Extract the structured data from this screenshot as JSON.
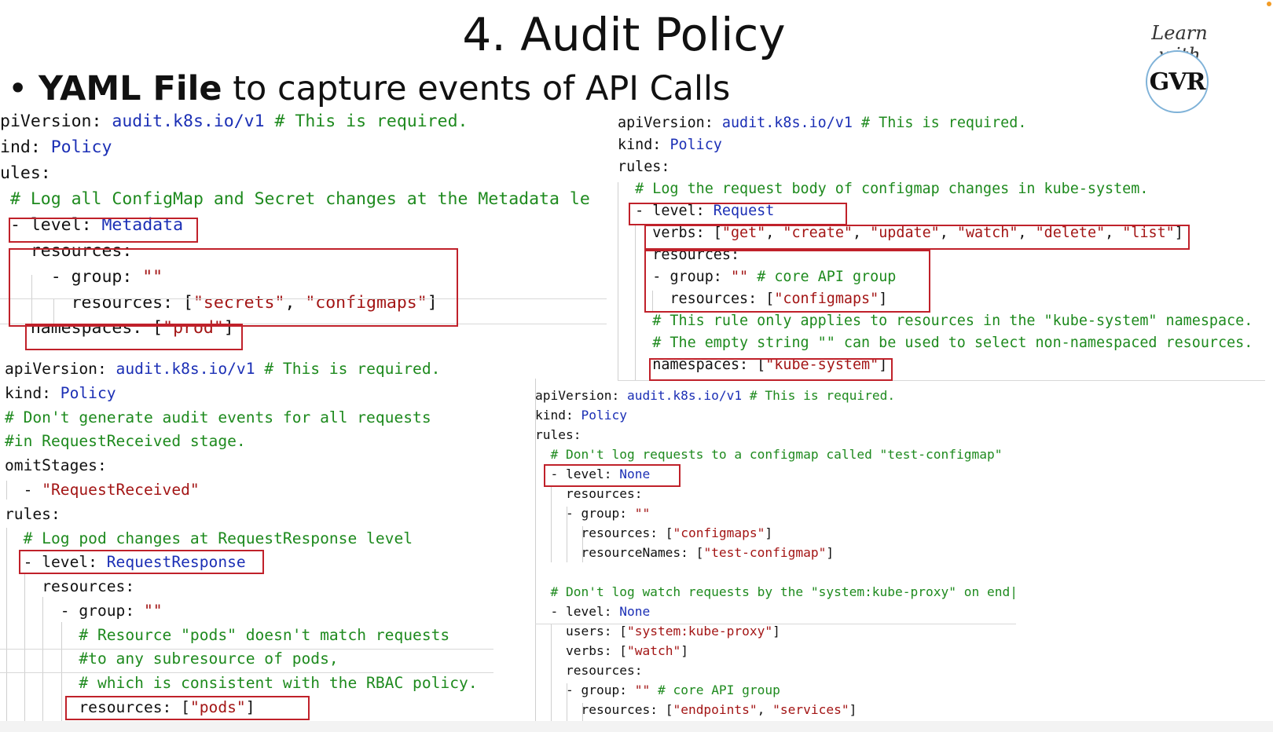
{
  "title": "4. Audit Policy",
  "bullet": {
    "bold": "YAML File",
    "rest": " to capture events of API Calls"
  },
  "logo": {
    "text": "Learn with",
    "mark": "GVR"
  },
  "panel1": [
    "piVersion: audit.k8s.io/v1 # This is required.",
    "ind: Policy",
    "ules:",
    " # Log all ConfigMap and Secret changes at the Metadata le",
    " - level: Metadata",
    "   resources:",
    "     - group: \"\"",
    "       resources: [\"secrets\", \"configmaps\"]",
    "   namespaces: [\"prod\"]"
  ],
  "panel2": [
    "apiVersion: audit.k8s.io/v1 # This is required.",
    "kind: Policy",
    "rules:",
    "  # Log the request body of configmap changes in kube-system.",
    "  - level: Request",
    "    verbs: [\"get\", \"create\", \"update\", \"watch\", \"delete\", \"list\"]",
    "    resources:",
    "    - group: \"\" # core API group",
    "      resources: [\"configmaps\"]",
    "    # This rule only applies to resources in the \"kube-system\" namespace.",
    "    # The empty string \"\" can be used to select non-namespaced resources.",
    "    namespaces: [\"kube-system\"]"
  ],
  "panel3": [
    "apiVersion: audit.k8s.io/v1 # This is required.",
    "kind: Policy",
    "# Don't generate audit events for all requests",
    "#in RequestReceived stage.",
    "omitStages:",
    "  - \"RequestReceived\"",
    "rules:",
    "  # Log pod changes at RequestResponse level",
    "  - level: RequestResponse",
    "    resources:",
    "      - group: \"\"",
    "        # Resource \"pods\" doesn't match requests",
    "        #to any subresource of pods,",
    "        # which is consistent with the RBAC policy.",
    "        resources: [\"pods\"]"
  ],
  "panel4": [
    "apiVersion: audit.k8s.io/v1 # This is required.",
    "kind: Policy",
    "rules:",
    "  # Don't log requests to a configmap called \"test-configmap\"",
    "  - level: None",
    "    resources:",
    "    - group: \"\"",
    "      resources: [\"configmaps\"]",
    "      resourceNames: [\"test-configmap\"]",
    "",
    "  # Don't log watch requests by the \"system:kube-proxy\" on end|",
    "  - level: None",
    "    users: [\"system:kube-proxy\"]",
    "    verbs: [\"watch\"]",
    "    resources:",
    "    - group: \"\" # core API group",
    "      resources: [\"endpoints\", \"services\"]"
  ],
  "colors": {
    "key": "#111111",
    "value": "#1b2fb5",
    "comment": "#1e8a1e",
    "string": "#a31515",
    "highlight": "#c0212a"
  }
}
